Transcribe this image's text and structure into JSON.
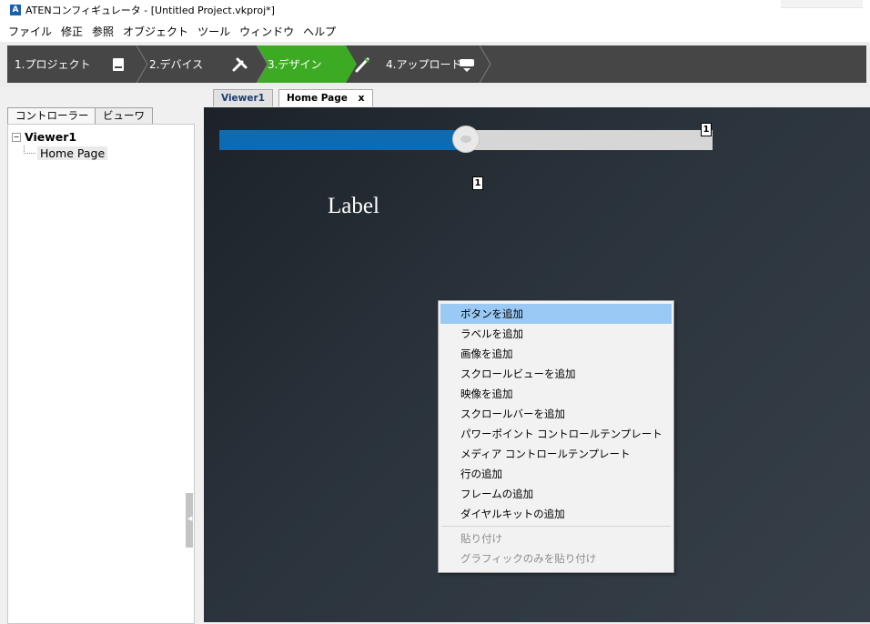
{
  "window": {
    "title": "ATENコンフィギュレータ - [Untitled Project.vkproj*]",
    "app_icon": "aten-logo-icon"
  },
  "menubar": {
    "items": [
      "ファイル",
      "修正",
      "参照",
      "オブジェクト",
      "ツール",
      "ウィンドウ",
      "ヘルプ"
    ]
  },
  "steps": {
    "items": [
      {
        "label": "1.プロジェクト",
        "icon": "device-icon"
      },
      {
        "label": "2.デバイス",
        "icon": "tools-icon"
      },
      {
        "label": "3.デザイン",
        "icon": "brush-icon"
      },
      {
        "label": "4.アップロード",
        "icon": "upload-device-icon"
      }
    ],
    "active_index": 2,
    "bar_color": "#464646",
    "active_color": "#3cab23"
  },
  "left_panel": {
    "tabs": [
      "コントローラー",
      "ビューワ"
    ],
    "tree": {
      "root": "Viewer1",
      "children": [
        "Home Page"
      ]
    }
  },
  "doc_tabs": {
    "items": [
      "Viewer1",
      "Home Page"
    ],
    "close_symbol": "x"
  },
  "canvas": {
    "slider": {
      "value": 0.5,
      "fill_color": "#0c6bb3",
      "track_color": "#d6d6d6"
    },
    "badge_top": "1",
    "badge_bottom": "1",
    "label_text": "Label"
  },
  "context_menu": {
    "groups": [
      [
        {
          "label": "ボタンを追加",
          "highlighted": true
        },
        {
          "label": "ラベルを追加"
        },
        {
          "label": "画像を追加"
        },
        {
          "label": "スクロールビューを追加"
        },
        {
          "label": "映像を追加"
        },
        {
          "label": "スクロールバーを追加"
        },
        {
          "label": "パワーポイント コントロールテンプレート"
        },
        {
          "label": "メディア コントロールテンプレート"
        },
        {
          "label": "行の追加"
        },
        {
          "label": "フレームの追加"
        },
        {
          "label": "ダイヤルキットの追加"
        }
      ],
      [
        {
          "label": "貼り付け",
          "disabled": true
        },
        {
          "label": "グラフィックのみを貼り付け",
          "disabled": true
        }
      ]
    ]
  }
}
